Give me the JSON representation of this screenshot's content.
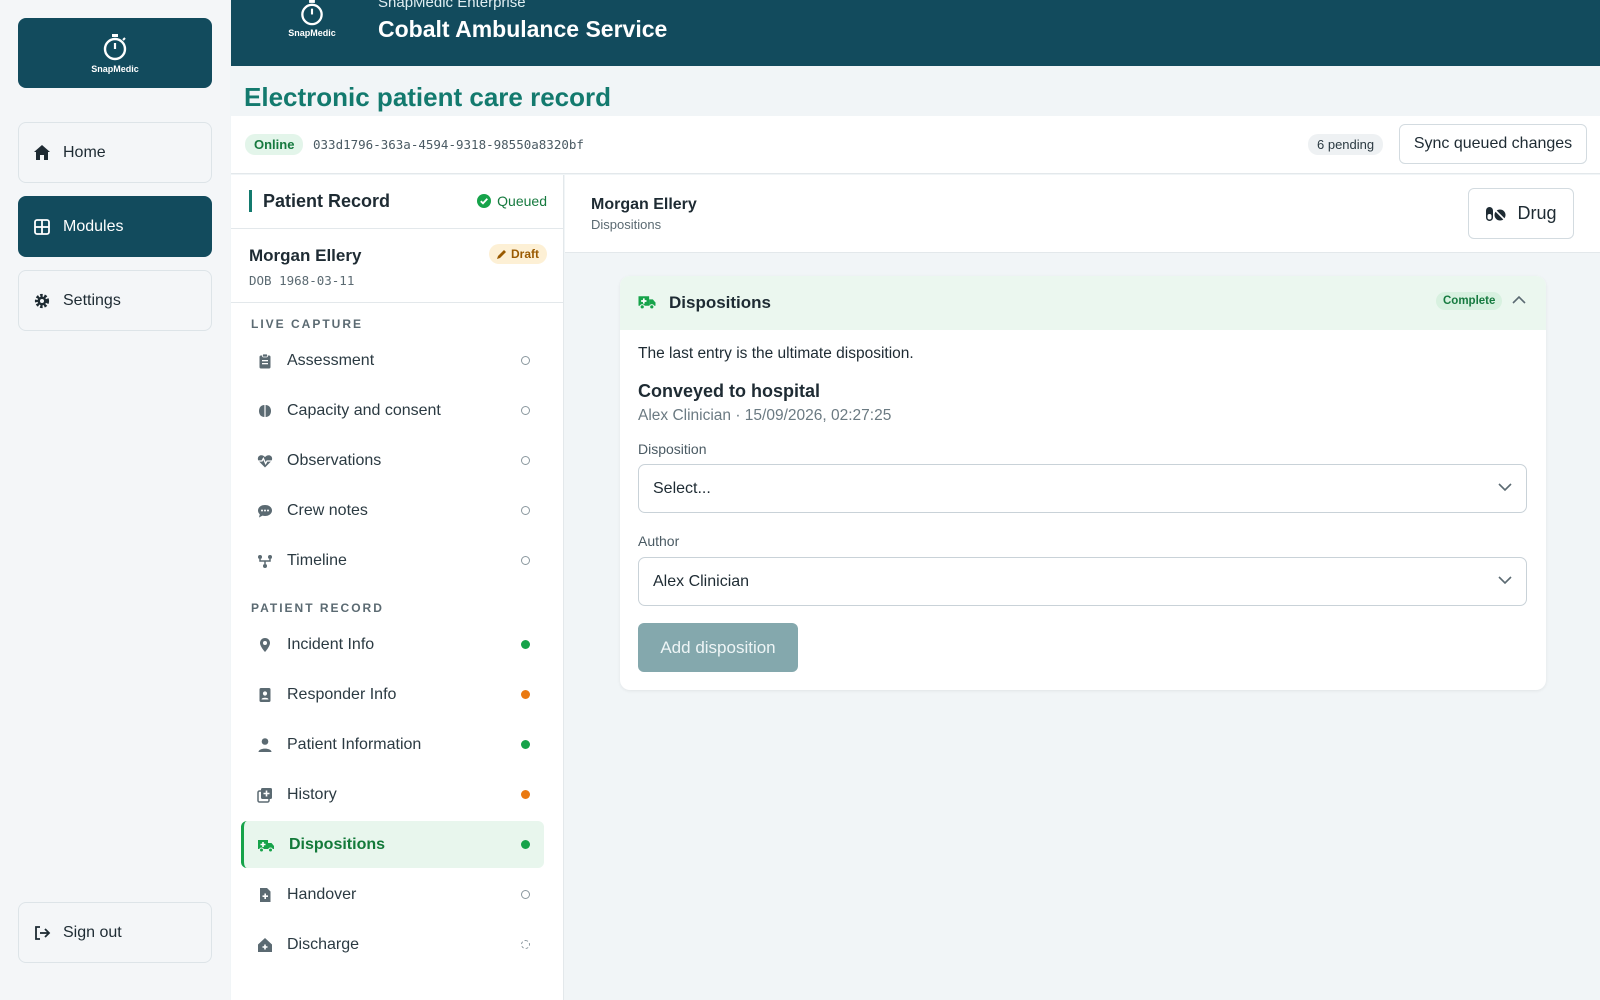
{
  "brand": {
    "logo_text": "SnapMedic"
  },
  "nav": {
    "home": "Home",
    "modules": "Modules",
    "settings": "Settings",
    "signout": "Sign out"
  },
  "header": {
    "product": "SnapMedic Enterprise",
    "org": "Cobalt Ambulance Service"
  },
  "page_title": "Electronic patient care record",
  "status": {
    "online": "Online",
    "record_id": "033d1796-363a-4594-9318-98550a8320bf",
    "pending": "6 pending",
    "sync_label": "Sync queued changes"
  },
  "sidebar": {
    "title": "Patient Record",
    "queued": "Queued",
    "patient_name": "Morgan Ellery",
    "dob": "DOB 1968-03-11",
    "draft": "Draft",
    "live_capture_label": "LIVE CAPTURE",
    "patient_record_label": "PATIENT RECORD",
    "live_items": [
      {
        "label": "Assessment",
        "status": "empty"
      },
      {
        "label": "Capacity and consent",
        "status": "empty"
      },
      {
        "label": "Observations",
        "status": "empty"
      },
      {
        "label": "Crew notes",
        "status": "empty"
      },
      {
        "label": "Timeline",
        "status": "empty"
      }
    ],
    "record_items": [
      {
        "label": "Incident Info",
        "status": "green"
      },
      {
        "label": "Responder Info",
        "status": "orange"
      },
      {
        "label": "Patient Information",
        "status": "green"
      },
      {
        "label": "History",
        "status": "orange"
      },
      {
        "label": "Dispositions",
        "status": "green"
      },
      {
        "label": "Handover",
        "status": "empty"
      },
      {
        "label": "Discharge",
        "status": "dashed"
      }
    ]
  },
  "main": {
    "patient_name": "Morgan Ellery",
    "section": "Dispositions",
    "drug_label": "Drug",
    "card": {
      "title": "Dispositions",
      "status": "Complete",
      "description": "The last entry is the ultimate disposition.",
      "last_disposition": "Conveyed to hospital",
      "last_meta": "Alex Clinician · 15/09/2026, 02:27:25",
      "disposition_label": "Disposition",
      "disposition_value": "Select...",
      "author_label": "Author",
      "author_value": "Alex Clinician",
      "add_label": "Add disposition"
    }
  },
  "colors": {
    "brand": "#124b5d",
    "accent": "#137a6e",
    "status_green": "#16a34a",
    "status_orange": "#ea7a12"
  }
}
